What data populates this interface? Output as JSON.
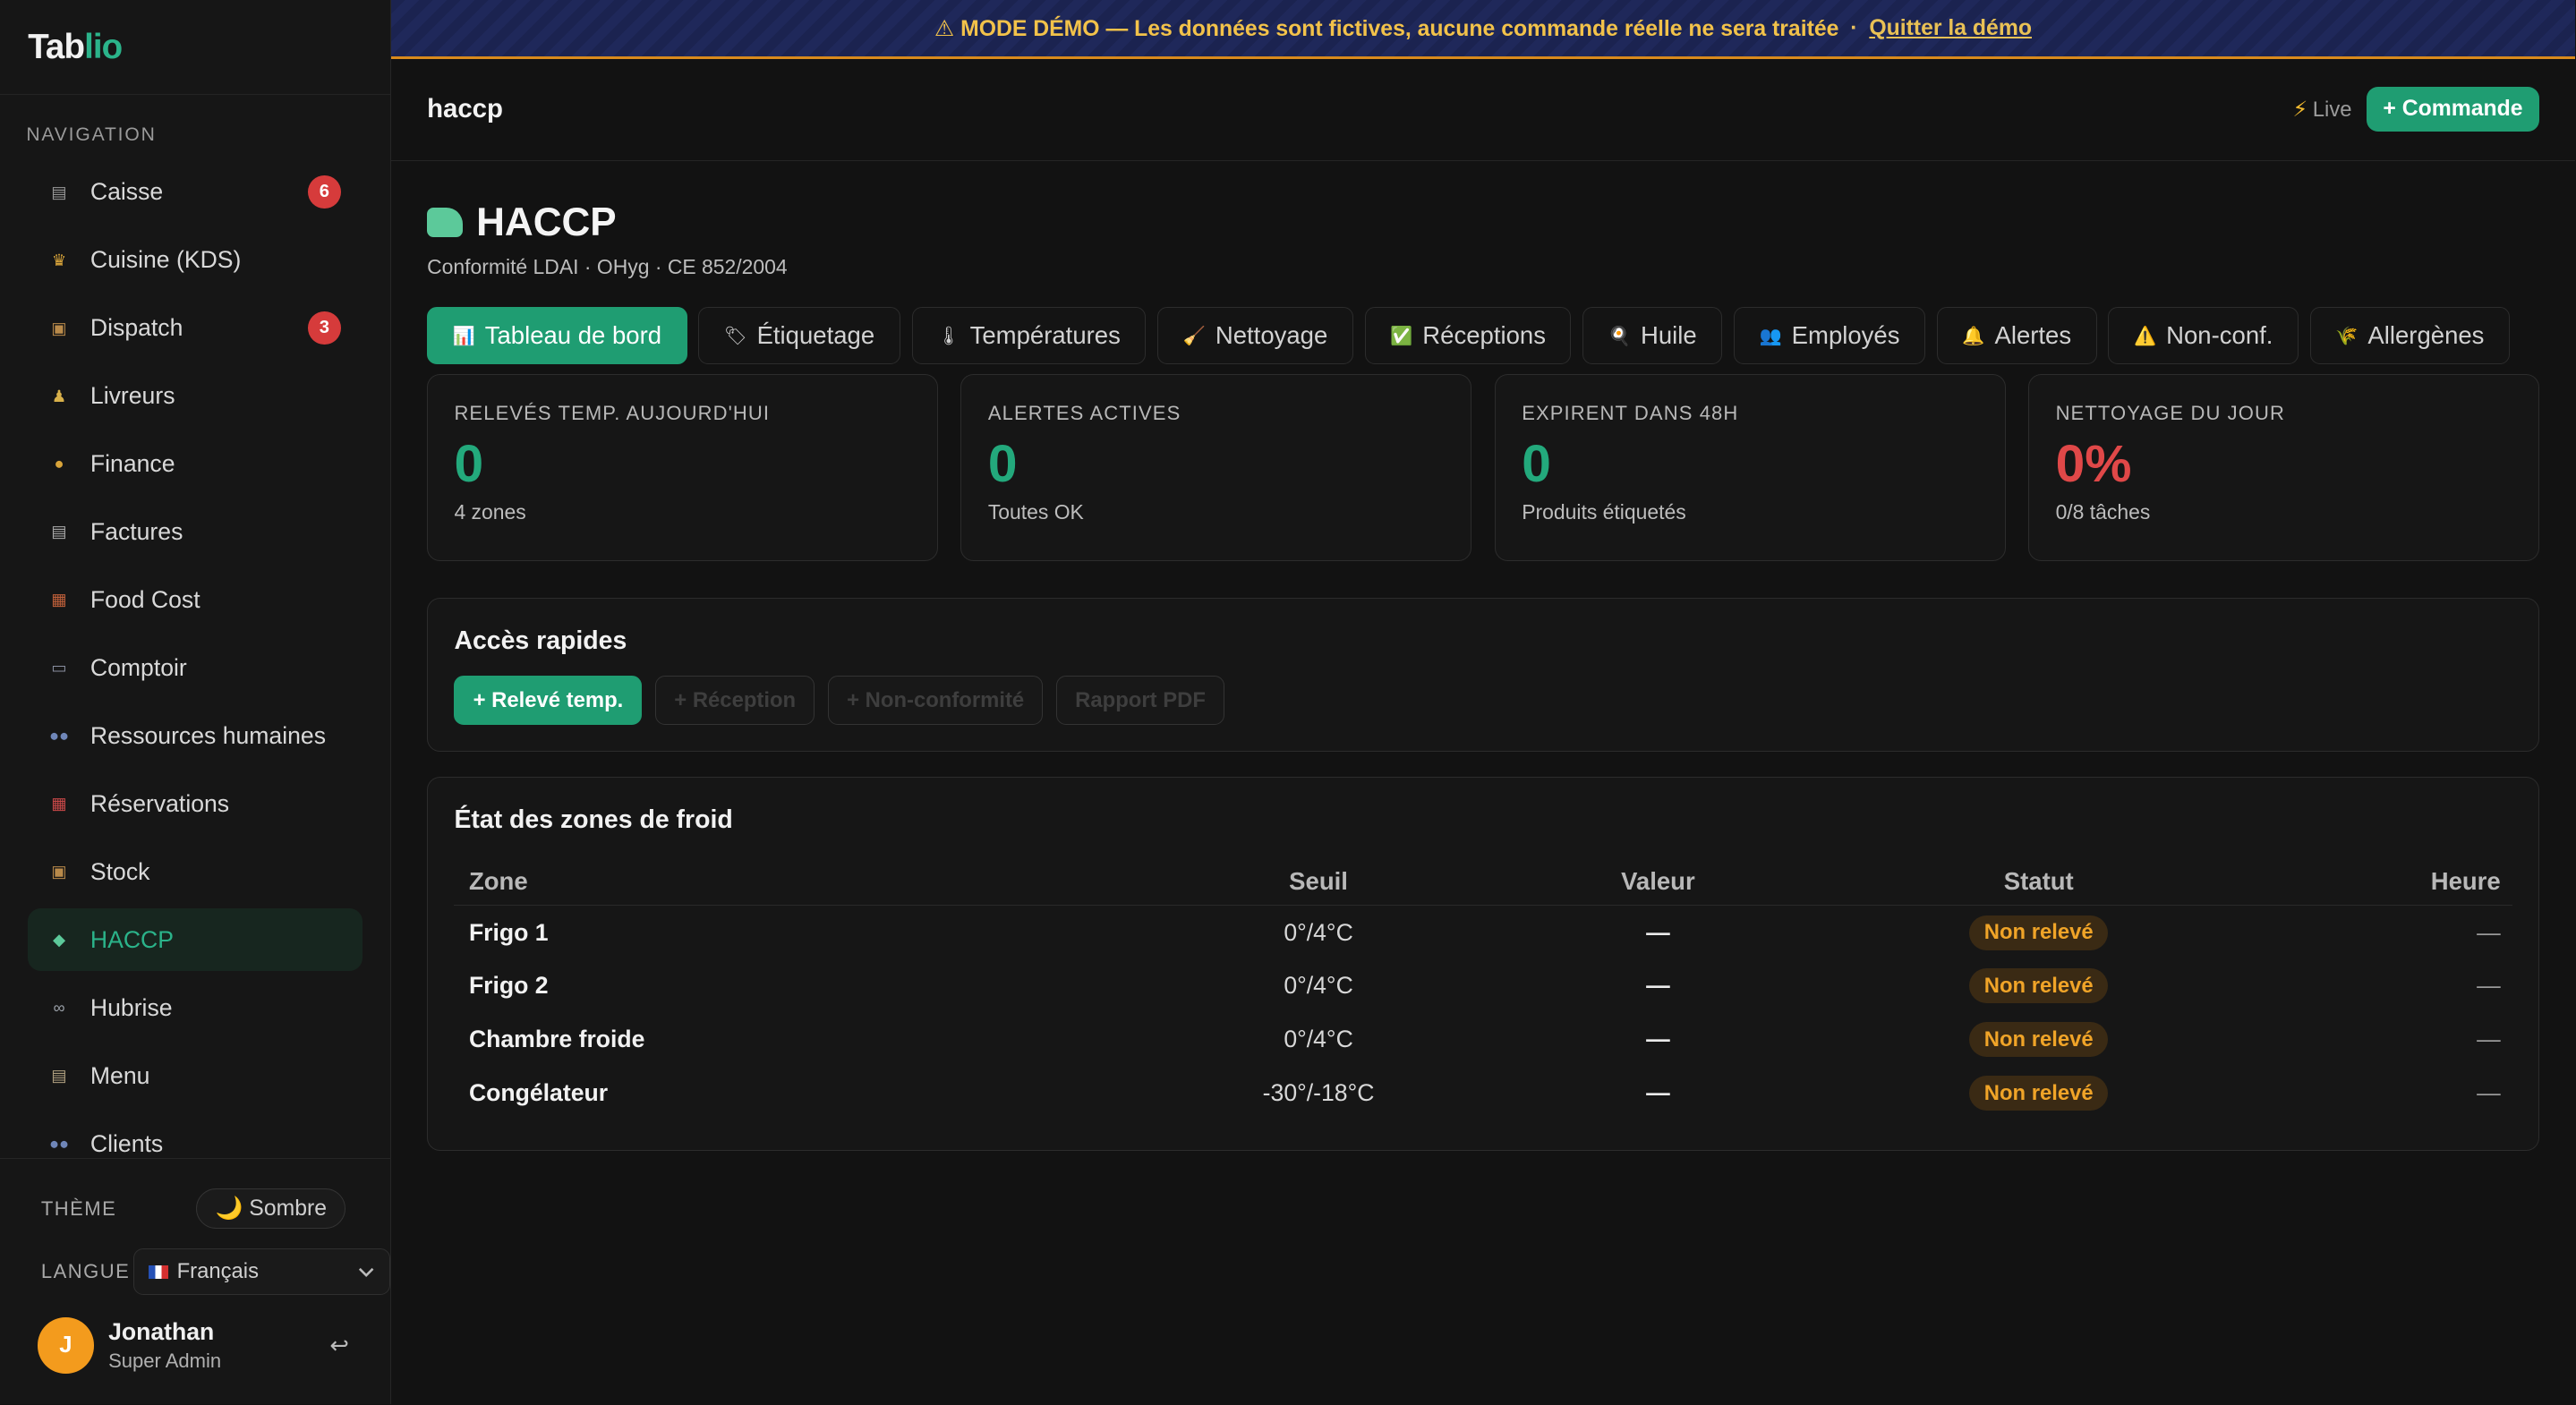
{
  "app": {
    "logo_main": "Tab",
    "logo_accent": "lio"
  },
  "sidebar": {
    "nav_label": "NAVIGATION",
    "items": [
      {
        "label": "Caisse",
        "icon": "register-icon",
        "badge": "6"
      },
      {
        "label": "Cuisine (KDS)",
        "icon": "chef-icon"
      },
      {
        "label": "Dispatch",
        "icon": "package-icon",
        "badge": "3"
      },
      {
        "label": "Livreurs",
        "icon": "runner-icon"
      },
      {
        "label": "Finance",
        "icon": "money-bag-icon"
      },
      {
        "label": "Factures",
        "icon": "receipt-icon"
      },
      {
        "label": "Food Cost",
        "icon": "food-cost-icon"
      },
      {
        "label": "Comptoir",
        "icon": "monitor-icon"
      },
      {
        "label": "Ressources humaines",
        "icon": "people-icon"
      },
      {
        "label": "Réservations",
        "icon": "calendar-icon"
      },
      {
        "label": "Stock",
        "icon": "box-icon"
      },
      {
        "label": "HACCP",
        "icon": "haccp-icon",
        "active": true
      },
      {
        "label": "Hubrise",
        "icon": "link-icon"
      },
      {
        "label": "Menu",
        "icon": "clipboard-icon"
      },
      {
        "label": "Clients",
        "icon": "people-icon"
      }
    ],
    "theme_label": "THÈME",
    "theme_value": "🌙 Sombre",
    "lang_label": "LANGUE",
    "lang_value": "Français",
    "user_initial": "J",
    "user_name": "Jonathan",
    "user_role": "Super Admin"
  },
  "banner": {
    "text": "⚠ MODE DÉMO — Les données sont fictives, aucune commande réelle ne sera traitée",
    "separator": "·",
    "quit_link": "Quitter la démo"
  },
  "topbar": {
    "slug": "haccp",
    "live": "Live",
    "command_button": "+ Commande"
  },
  "page": {
    "title": "HACCP",
    "subtitle": "Conformité LDAI · OHyg · CE 852/2004",
    "tabs": [
      {
        "icon": "📊",
        "label": "Tableau de bord",
        "active": true
      },
      {
        "icon": "🏷",
        "label": "Étiquetage"
      },
      {
        "icon": "🌡",
        "label": "Températures"
      },
      {
        "icon": "🧹",
        "label": "Nettoyage"
      },
      {
        "icon": "✅",
        "label": "Réceptions"
      },
      {
        "icon": "🍳",
        "label": "Huile"
      },
      {
        "icon": "👥",
        "label": "Employés"
      },
      {
        "icon": "🔔",
        "label": "Alertes"
      },
      {
        "icon": "⚠️",
        "label": "Non-conf."
      },
      {
        "icon": "🌾",
        "label": "Allergènes"
      }
    ]
  },
  "stats": [
    {
      "label": "Relevés temp. aujourd'hui",
      "value": "0",
      "sub": "4 zones",
      "color": "#23a97c"
    },
    {
      "label": "Alertes actives",
      "value": "0",
      "sub": "Toutes OK",
      "color": "#23a97c"
    },
    {
      "label": "Expirent dans 48h",
      "value": "0",
      "sub": "Produits étiquetés",
      "color": "#23a97c"
    },
    {
      "label": "Nettoyage du jour",
      "value": "0%",
      "sub": "0/8 tâches",
      "color": "#e04848"
    }
  ],
  "quick_access": {
    "title": "Accès rapides",
    "buttons": [
      "+ Relevé temp.",
      "+ Réception",
      "+ Non-conformité",
      "Rapport PDF"
    ]
  },
  "zones": {
    "title": "État des zones de froid",
    "headers": [
      "Zone",
      "Seuil",
      "Valeur",
      "Statut",
      "Heure"
    ],
    "rows": [
      {
        "zone": "Frigo 1",
        "threshold": "0°/4°C",
        "value": "—",
        "status": "Non relevé",
        "time": "—"
      },
      {
        "zone": "Frigo 2",
        "threshold": "0°/4°C",
        "value": "—",
        "status": "Non relevé",
        "time": "—"
      },
      {
        "zone": "Chambre froide",
        "threshold": "0°/4°C",
        "value": "—",
        "status": "Non relevé",
        "time": "—"
      },
      {
        "zone": "Congélateur",
        "threshold": "-30°/-18°C",
        "value": "—",
        "status": "Non relevé",
        "time": "—"
      }
    ]
  },
  "colors": {
    "accent": "#1f9d72",
    "danger": "#e04848",
    "warning": "#f0a428"
  }
}
